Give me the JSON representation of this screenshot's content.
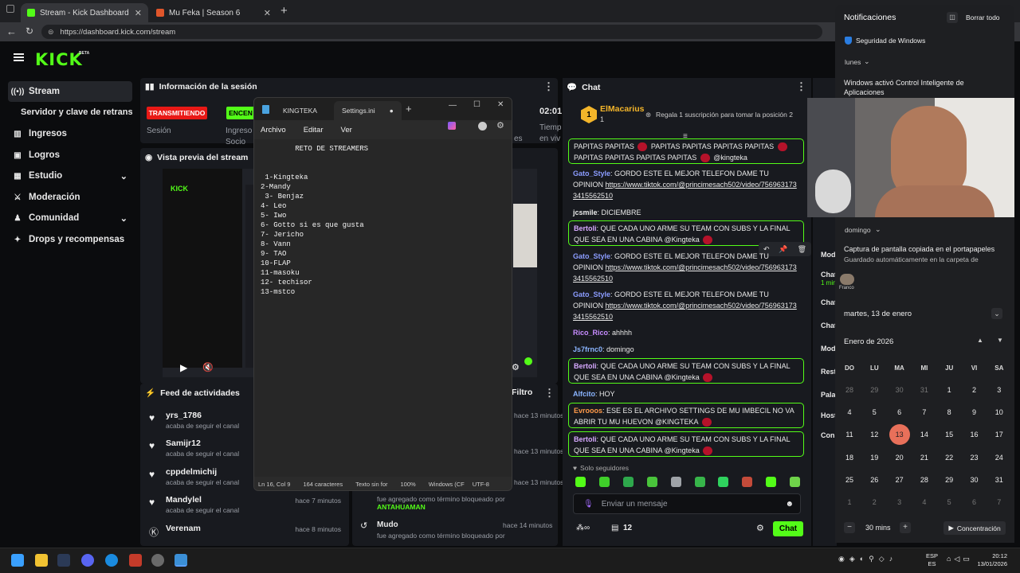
{
  "browser": {
    "tabs": [
      {
        "title": "Stream - Kick Dashboard",
        "color": "#53fc18"
      },
      {
        "title": "Mu Feka | Season 6",
        "color": "#e0562b"
      }
    ],
    "url": "https://dashboard.kick.com/stream"
  },
  "kick": {
    "logo": "KICK",
    "beta": "BETA",
    "brand_color": "#53fc18",
    "sidebar": [
      {
        "label": "Stream",
        "icon": "stream-icon"
      },
      {
        "label": "Servidor y clave de retransmisión",
        "icon": ""
      },
      {
        "label": "Ingresos",
        "icon": "income-icon"
      },
      {
        "label": "Logros",
        "icon": "trophy-icon"
      },
      {
        "label": "Estudio",
        "icon": "studio-icon"
      },
      {
        "label": "Moderación",
        "icon": "sword-icon"
      },
      {
        "label": "Comunidad",
        "icon": "community-icon"
      },
      {
        "label": "Drops y recompensas",
        "icon": "gift-icon"
      }
    ],
    "session": {
      "title": "Información de la sesión",
      "status": "TRANSMITIENDO",
      "encen": "ENCEN",
      "col1": "Sesión",
      "col2a": "Ingreso",
      "col2b": "Socio",
      "time": "02:01",
      "col3a": "Tiemp",
      "col3b": "en viv",
      "col_es": "es"
    },
    "preview": {
      "title": "Vista previa del stream"
    },
    "feed": {
      "title": "Feed de actividades",
      "items": [
        {
          "name": "yrs_1786",
          "sub": "acaba de seguir el canal",
          "time": ""
        },
        {
          "name": "Samijr12",
          "sub": "acaba de seguir el canal",
          "time": ""
        },
        {
          "name": "cppdelmichij",
          "sub": "acaba de seguir el canal",
          "time": ""
        },
        {
          "name": "Mandylel",
          "sub": "acaba de seguir el canal",
          "time": "hace 7 minutos"
        },
        {
          "name": "Verenam",
          "sub": "",
          "time": "hace 8 minutos"
        }
      ]
    },
    "mod": {
      "title": "Filtro",
      "times": [
        "hace 13 minutos",
        "hace 13 minutos",
        "hace 13 minutos"
      ],
      "blocked_text": "fue agregado como término bloqueado por",
      "blocked_user": "ANTAHUAMAN",
      "mute_label": "Mudo",
      "mute_time": "hace 14 minutos",
      "mute_text": "fue agregado como término bloqueado por"
    },
    "chat": {
      "title": "Chat",
      "gifter": "ElMacarius",
      "gifter_count": "1",
      "rank": "1",
      "gift_promo": "Regala 1 suscripción para tomar la posición 2",
      "messages": [
        {
          "user": "",
          "text": "PAPITAS PAPITAS 🔥 PAPITAS PAPITAS PAPITAS PAPITAS 🔥 PAPITAS PAPITAS PAPITAS PAPITAS 🔥 @kingteka",
          "hl": true,
          "color": "#eaeaea"
        },
        {
          "user": "Gato_Style",
          "text": "GORDO ESTE EL MEJOR TELEFON DAME TU OPINION",
          "link": "https://www.tiktok.com/@princimesach502/video/7569631733415562510",
          "hl": false,
          "color": "#8b9cff"
        },
        {
          "user": "jcsmile",
          "text": "DICIEMBRE",
          "hl": false,
          "color": "#ffffff"
        },
        {
          "user": "Bertoli",
          "text": "QUE CADA UNO ARME SU TEAM CON SUBS Y LA FINAL QUE SEA EN UNA CABINA @Kingteka",
          "hl": true,
          "color": "#d7a9ff"
        },
        {
          "user": "Gato_Style",
          "text": "GORDO ESTE EL MEJOR TELEFON DAME TU OPINION",
          "link": "https://www.tiktok.com/@princimesach502/video/7569631733415562510",
          "hl": false,
          "color": "#8b9cff"
        },
        {
          "user": "Gato_Style",
          "text": "GORDO ESTE EL MEJOR TELEFON DAME TU OPINION",
          "link": "https://www.tiktok.com/@princimesach502/video/7569631733415562510",
          "hl": false,
          "color": "#8b9cff"
        },
        {
          "user": "Rico_Rico",
          "text": "ahhhh",
          "hl": false,
          "color": "#c78cff"
        },
        {
          "user": "Js7frnc0",
          "text": "domingo",
          "hl": false,
          "color": "#8ab4ff"
        },
        {
          "user": "Bertoli",
          "text": "QUE CADA UNO ARME SU TEAM CON SUBS Y LA FINAL QUE SEA EN UNA CABINA @Kingteka",
          "hl": true,
          "color": "#d7a9ff"
        },
        {
          "user": "Alfcito",
          "text": "HOY",
          "hl": false,
          "color": "#8ab4ff"
        },
        {
          "user": "Evrooos",
          "text": "ESE ES EL ARCHIVO SETTINGS DE MU IMBECIL NO VA ABRIR TU MU HUEVON @KINGTEKA",
          "hl": true,
          "color": "#ff9a4a"
        },
        {
          "user": "Bertoli",
          "text": "QUE CADA UNO ARME SU TEAM CON SUBS Y LA FINAL QUE SEA EN UNA CABINA @Kingteka",
          "hl": true,
          "color": "#d7a9ff"
        }
      ],
      "followers_only": "Solo seguidores",
      "input_placeholder": "Enviar un mensaje",
      "viewers": "12",
      "send_label": "Chat"
    }
  },
  "notepad": {
    "tabs": [
      "KINGTEKA",
      "Settings.ini"
    ],
    "menu": [
      "Archivo",
      "Editar",
      "Ver"
    ],
    "content": "        RETO DE STREAMERS\n\n\n 1-Kingteka\n2-Mandy\n 3- Benjaz\n4- Leo\n5- Iwo\n6- Gotto si es que gusta\n7- Jericho\n8- Vann\n9- TAO\n10-FLAP\n11-masoku\n12- techisor\n13-mstco",
    "status": [
      "Ln 16, Col 9",
      "164 caracteres",
      "Texto sin for",
      "100%",
      "Windows (CF",
      "UTF-8"
    ]
  },
  "notifications": {
    "title": "Notificaciones",
    "clear_all": "Borrar todo",
    "app1": "Seguridad de Windows",
    "day1": "lunes",
    "msg1": "Windows activó Control Inteligente de Aplicaciones",
    "day2": "domingo",
    "msg2_title": "Captura de pantalla copiada en el portapapeles",
    "msg2_body": "Guardado automáticamente en la carpeta de",
    "peek_user": "Franco"
  },
  "right_peek": [
    "Mod",
    "Chat",
    "1 min",
    "Chat",
    "Chat",
    "Mod",
    "Rest",
    "Pala",
    "Host",
    "Con"
  ],
  "calendar": {
    "date_header": "martes, 13 de enero",
    "month": "Enero de 2026",
    "dow": [
      "DO",
      "LU",
      "MA",
      "MI",
      "JU",
      "VI",
      "SA"
    ],
    "weeks": [
      [
        "28",
        "29",
        "30",
        "31",
        "1",
        "2",
        "3"
      ],
      [
        "4",
        "5",
        "6",
        "7",
        "8",
        "9",
        "10"
      ],
      [
        "11",
        "12",
        "13",
        "14",
        "15",
        "16",
        "17"
      ],
      [
        "18",
        "19",
        "20",
        "21",
        "22",
        "23",
        "24"
      ],
      [
        "25",
        "26",
        "27",
        "28",
        "29",
        "30",
        "31"
      ],
      [
        "1",
        "2",
        "3",
        "4",
        "5",
        "6",
        "7"
      ]
    ],
    "today": "13",
    "focus_minutes": "30 mins",
    "focus_label": "Concentración"
  },
  "taskbar": {
    "lang": "ESP",
    "lang2": "ES",
    "time": "20:12",
    "date": "13/01/2026"
  }
}
